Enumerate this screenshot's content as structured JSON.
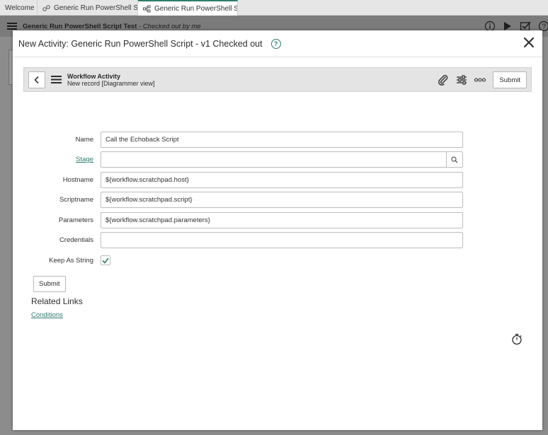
{
  "tabs": [
    {
      "label": "Welcome",
      "icon": "none"
    },
    {
      "label": "Generic Run PowerShell Sc...",
      "icon": "workflow-icon"
    },
    {
      "label": "Generic Run PowerShell Sc...",
      "icon": "workflow-icon",
      "active": true
    }
  ],
  "app_header": {
    "title": "Generic Run PowerShell Script Test",
    "subtitle": "- Checked out by me"
  },
  "modal": {
    "title": "New Activity: Generic Run PowerShell Script - v1 Checked out",
    "help_glyph": "?"
  },
  "form_header": {
    "line1": "Workflow Activity",
    "line2": "New record [Diagrammer view]",
    "submit_label": "Submit"
  },
  "form": {
    "fields": {
      "name": {
        "label": "Name",
        "value": "Call the Echoback Script"
      },
      "stage": {
        "label": "Stage",
        "value": ""
      },
      "hostname": {
        "label": "Hostname",
        "value": "${workflow.scratchpad.host}"
      },
      "scriptname": {
        "label": "Scriptname",
        "value": "${workflow.scratchpad.script}"
      },
      "parameters": {
        "label": "Parameters",
        "value": "${workflow.scratchpad.parameters}"
      },
      "credentials": {
        "label": "Credentials",
        "value": ""
      },
      "keep_as_string": {
        "label": "Keep As String",
        "checked": true
      }
    },
    "submit_label": "Submit"
  },
  "related_links": {
    "heading": "Related Links",
    "items": [
      "Conditions"
    ]
  },
  "colors": {
    "accent": "#2f7d6d",
    "overlay": "#8c8c8c"
  }
}
